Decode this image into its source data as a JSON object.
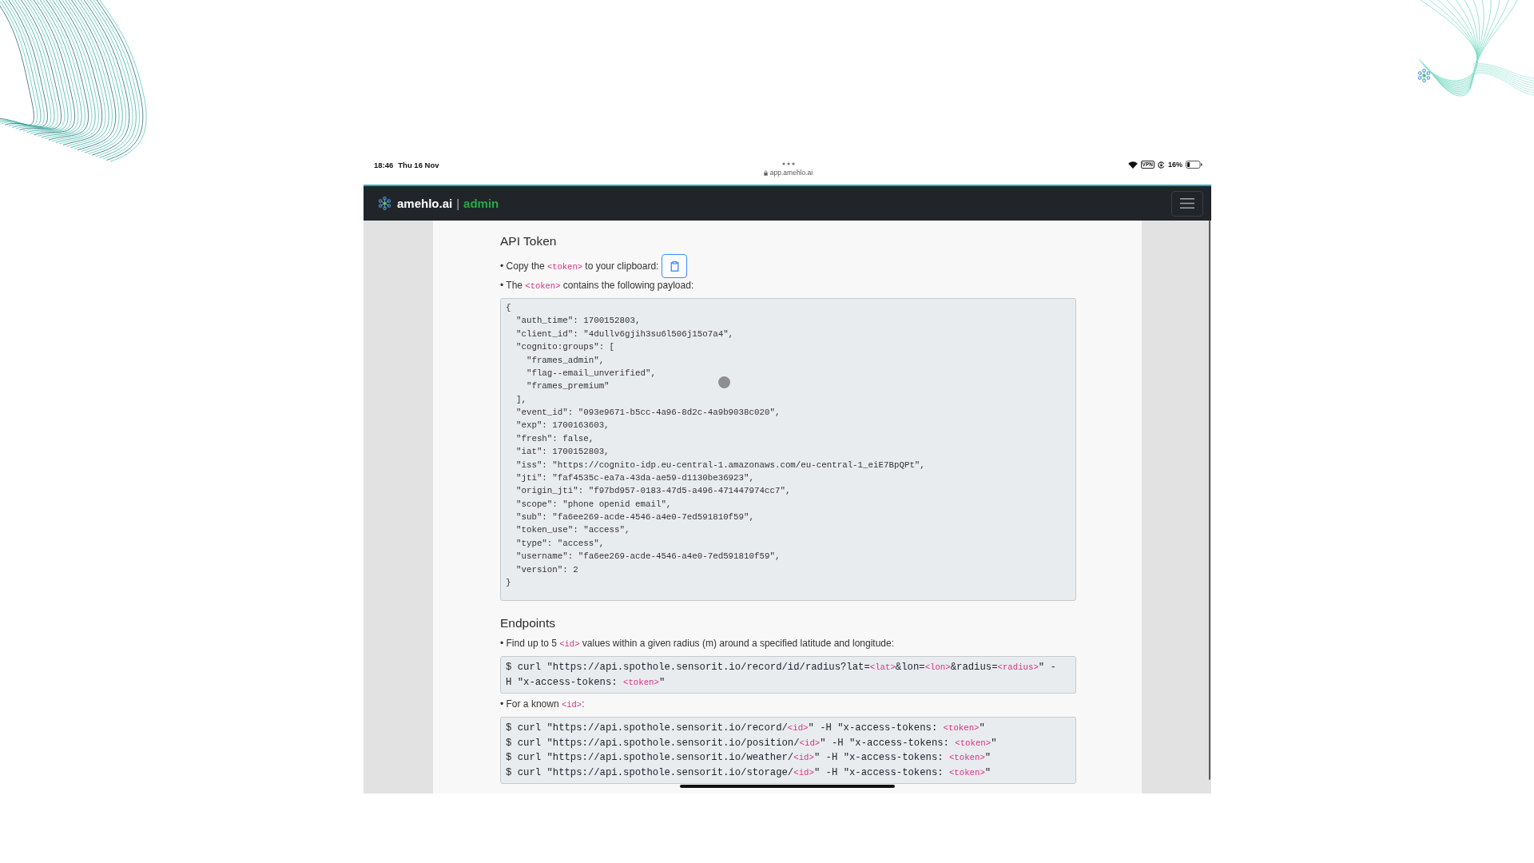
{
  "status_bar": {
    "time": "18:46",
    "date": "Thu 16 Nov",
    "url": "app.amehlo.ai",
    "vpn_badge": "VPN",
    "battery_percent": "16%"
  },
  "navbar": {
    "brand": "amehlo.ai",
    "separator": "|",
    "section": "admin"
  },
  "sections": [
    {
      "heading": "API Token",
      "items": [
        {
          "kind": "bullet",
          "copy_button": true,
          "segments": [
            {
              "kind": "text",
              "text": "• Copy the "
            },
            {
              "kind": "code",
              "text": "<token>"
            },
            {
              "kind": "text",
              "text": " to your clipboard:"
            }
          ]
        },
        {
          "kind": "bullet",
          "copy_button": false,
          "segments": [
            {
              "kind": "text",
              "text": "• The "
            },
            {
              "kind": "code",
              "text": "<token>"
            },
            {
              "kind": "text",
              "text": " contains the following payload:"
            }
          ]
        },
        {
          "kind": "payload_block",
          "lines": [
            "{",
            "  \"auth_time\": 1700152803,",
            "  \"client_id\": \"4dullv6gjih3su6l506j15o7a4\",",
            "  \"cognito:groups\": [",
            "    \"frames_admin\",",
            "    \"flag--email_unverified\",",
            "    \"frames_premium\"",
            "  ],",
            "  \"event_id\": \"093e9671-b5cc-4a96-8d2c-4a9b9038c020\",",
            "  \"exp\": 1700163603,",
            "  \"fresh\": false,",
            "  \"iat\": 1700152803,",
            "  \"iss\": \"https://cognito-idp.eu-central-1.amazonaws.com/eu-central-1_eiE7BpQPt\",",
            "  \"jti\": \"faf4535c-ea7a-43da-ae59-d1130be36923\",",
            "  \"origin_jti\": \"f97bd957-0183-47d5-a496-471447974cc7\",",
            "  \"scope\": \"phone openid email\",",
            "  \"sub\": \"fa6ee269-acde-4546-a4e0-7ed591810f59\",",
            "  \"token_use\": \"access\",",
            "  \"type\": \"access\",",
            "  \"username\": \"fa6ee269-acde-4546-a4e0-7ed591810f59\",",
            "  \"version\": 2",
            "}"
          ]
        }
      ]
    },
    {
      "heading": "Endpoints",
      "items": [
        {
          "kind": "bullet",
          "copy_button": false,
          "segments": [
            {
              "kind": "text",
              "text": "• Find up to 5 "
            },
            {
              "kind": "code",
              "text": "<id>"
            },
            {
              "kind": "text",
              "text": " values within a given radius (m) around a specified latitude and longitude:"
            }
          ]
        },
        {
          "kind": "command_block",
          "lines": [
            [
              {
                "kind": "text",
                "text": "$ curl \"https://api.spothole.sensorit.io/record/id/radius?lat="
              },
              {
                "kind": "code",
                "text": "<lat>"
              },
              {
                "kind": "text",
                "text": "&lon="
              },
              {
                "kind": "code",
                "text": "<lon>"
              },
              {
                "kind": "text",
                "text": "&radius="
              },
              {
                "kind": "code",
                "text": "<radius>"
              },
              {
                "kind": "text",
                "text": "\" -"
              }
            ],
            [
              {
                "kind": "text",
                "text": "H \"x-access-tokens: "
              },
              {
                "kind": "code",
                "text": "<token>"
              },
              {
                "kind": "text",
                "text": "\""
              }
            ]
          ]
        },
        {
          "kind": "bullet",
          "copy_button": false,
          "segments": [
            {
              "kind": "text",
              "text": "• For a known "
            },
            {
              "kind": "code",
              "text": "<id>"
            },
            {
              "kind": "text",
              "text": ":"
            }
          ]
        },
        {
          "kind": "command_block",
          "lines": [
            [
              {
                "kind": "text",
                "text": "$ curl \"https://api.spothole.sensorit.io/record/"
              },
              {
                "kind": "code",
                "text": "<id>"
              },
              {
                "kind": "text",
                "text": "\" -H \"x-access-tokens: "
              },
              {
                "kind": "code",
                "text": "<token>"
              },
              {
                "kind": "text",
                "text": "\""
              }
            ],
            [
              {
                "kind": "text",
                "text": "$ curl \"https://api.spothole.sensorit.io/position/"
              },
              {
                "kind": "code",
                "text": "<id>"
              },
              {
                "kind": "text",
                "text": "\" -H \"x-access-tokens: "
              },
              {
                "kind": "code",
                "text": "<token>"
              },
              {
                "kind": "text",
                "text": "\""
              }
            ],
            [
              {
                "kind": "text",
                "text": "$ curl \"https://api.spothole.sensorit.io/weather/"
              },
              {
                "kind": "code",
                "text": "<id>"
              },
              {
                "kind": "text",
                "text": "\" -H \"x-access-tokens: "
              },
              {
                "kind": "code",
                "text": "<token>"
              },
              {
                "kind": "text",
                "text": "\""
              }
            ],
            [
              {
                "kind": "text",
                "text": "$ curl \"https://api.spothole.sensorit.io/storage/"
              },
              {
                "kind": "code",
                "text": "<id>"
              },
              {
                "kind": "text",
                "text": "\" -H \"x-access-tokens: "
              },
              {
                "kind": "code",
                "text": "<token>"
              },
              {
                "kind": "text",
                "text": "\""
              }
            ]
          ]
        }
      ]
    }
  ]
}
